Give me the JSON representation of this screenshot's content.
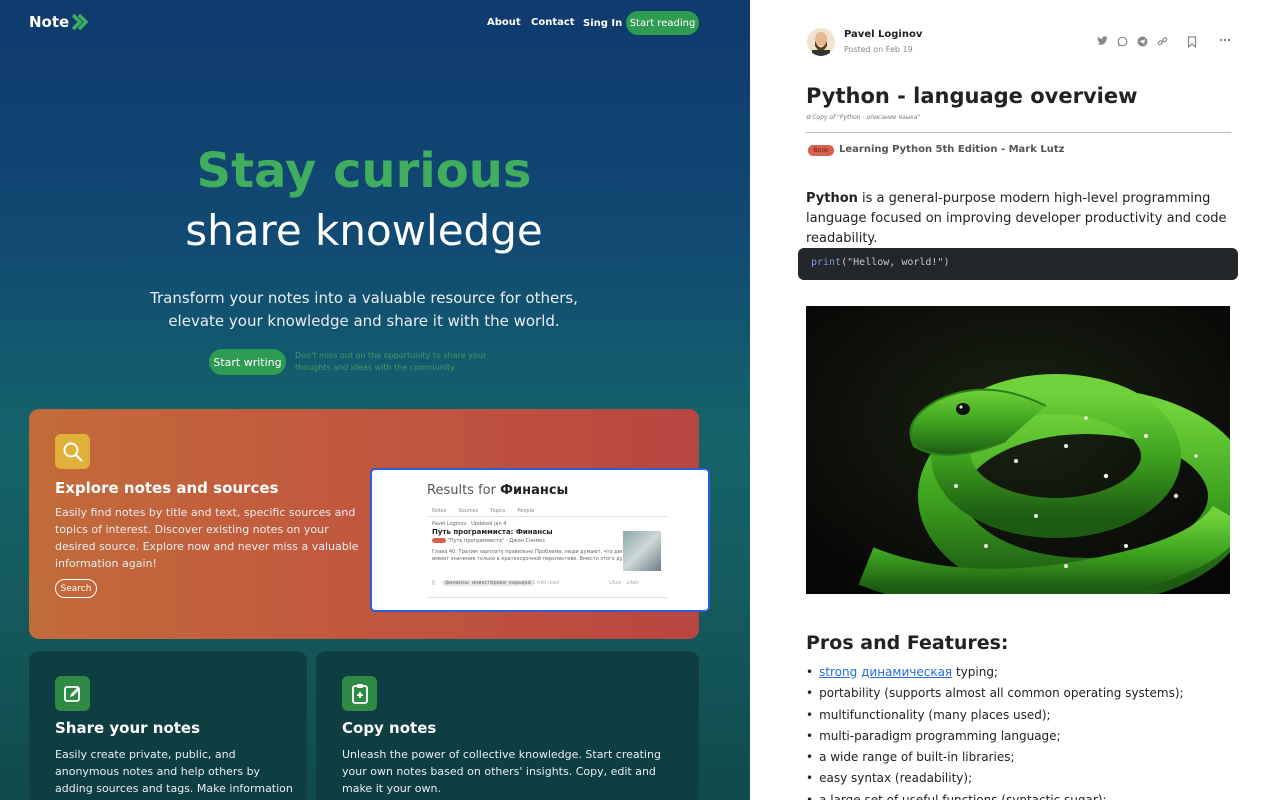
{
  "landing": {
    "logo_text": "Note",
    "nav": {
      "about": "About",
      "contact": "Contact",
      "sign_in": "Sing In",
      "start_reading": "Start reading"
    },
    "hero": {
      "title_line1": "Stay curious",
      "title_line2": "share knowledge",
      "subtitle_line1": "Transform your notes into a valuable resource for others,",
      "subtitle_line2": "elevate your knowledge and share it with the world.",
      "cta": "Start writing",
      "hint": "Don't miss out on the opportunity to share your thoughts and ideas with the community"
    },
    "explore": {
      "title": "Explore notes and sources",
      "text": "Easily find notes by title and text, specific sources and topics of interest. Discover existing notes on your desired source. Explore now and never miss a valuable information again!",
      "button": "Search",
      "preview": {
        "results_prefix": "Results for",
        "results_query": "Финансы",
        "tabs": [
          "Notes",
          "Sources",
          "Topics",
          "People"
        ],
        "author_line": "Pavel Loginov · Updated jan 4",
        "note_title": "Путь программиста: Финансы",
        "source_line": "\"Путь программиста\" - Джон Сонмез",
        "excerpt_1": "Глава 40: Тратим зарплату правильно Проблема: люди думают, что деньги",
        "excerpt_2": "имеют значение только в краткосрочной перспективе. Вместо этого дума...",
        "tags": [
          "финансы",
          "инвестирование",
          "карьера"
        ],
        "read_time": "11 min read",
        "stats": "Likes · Likes"
      }
    },
    "share": {
      "title": "Share your notes",
      "text": "Easily create private, public, and anonymous notes and help others by adding sources and tags. Make information discoverable and"
    },
    "copy": {
      "title": "Copy notes",
      "text": "Unleash the power of collective knowledge. Start creating your own notes based on others' insights. Copy, edit and make it your own."
    },
    "colors": {
      "accent_green": "#2e9b52",
      "hero_green": "#3fae5f",
      "card_red": "#c1553f",
      "card_dark": "#0e3d42"
    }
  },
  "article": {
    "author": "Pavel Loginov",
    "posted": "Posted on Feb 19",
    "title": "Python - language overview",
    "copy_of": "Copy of \"Python - описание языка\"",
    "book_badge": "Book",
    "book_title": "Learning Python 5th Edition - Mark Lutz",
    "intro_bold": "Python",
    "intro_rest": " is a general-purpose modern high-level programming language focused on improving developer productivity and code readability.",
    "code_fn": "print",
    "code_args": "(\"Hellow, world!\")",
    "image_alt": "green tree python",
    "section_title": "Pros and Features:",
    "features_first_link1": "strong",
    "features_first_link2": "динамическая",
    "features_first_rest": " typing;",
    "features": [
      "portability (supports almost all common operating systems);",
      "multifunctionality (many places used);",
      "multi-paradigm programming language;",
      "a wide range of built-in libraries;",
      "easy syntax (readability);",
      "a large set of useful functions (syntactic sugar);"
    ],
    "actions": [
      "twitter-icon",
      "whatsapp-icon",
      "telegram-icon",
      "link-icon",
      "bookmark-icon",
      "more-icon"
    ]
  }
}
